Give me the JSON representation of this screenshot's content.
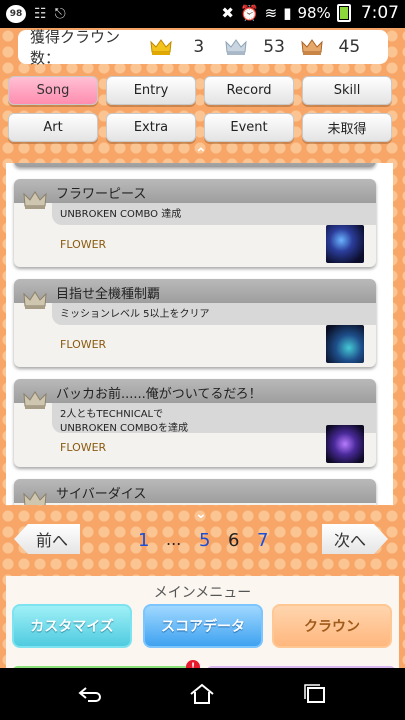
{
  "status_bar": {
    "notification_badge": "98",
    "battery_percent": "98%",
    "time": "7:07"
  },
  "crown_summary": {
    "label": "獲得クラウン数：",
    "gold": "3",
    "silver": "53",
    "bronze": "45",
    "colors": {
      "gold": "#f3c21b",
      "silver": "#b8c8d6",
      "bronze": "#d99a5b"
    }
  },
  "tabs": [
    {
      "label": "Song",
      "active": true
    },
    {
      "label": "Entry",
      "active": false
    },
    {
      "label": "Record",
      "active": false
    },
    {
      "label": "Skill",
      "active": false
    },
    {
      "label": "Art",
      "active": false
    },
    {
      "label": "Extra",
      "active": false
    },
    {
      "label": "Event",
      "active": false
    },
    {
      "label": "未取得",
      "active": false
    }
  ],
  "cards": [
    {
      "title": "フラワーピース",
      "desc": "UNBROKEN COMBO 達成",
      "song": "FLOWER"
    },
    {
      "title": "目指せ全機種制覇",
      "desc": "ミッションレベル 5以上をクリア",
      "song": "FLOWER"
    },
    {
      "title": "バッカお前......俺がついてるだろ！",
      "desc_line1": "2人ともTECHNICALで",
      "desc_line2": "UNBROKEN COMBOを達成",
      "song": "FLOWER"
    },
    {
      "title": "サイバーダイス"
    }
  ],
  "pager": {
    "prev": "前へ",
    "next": "次へ",
    "pages": {
      "first": "1",
      "dots": "...",
      "p5": "5",
      "current": "6",
      "p7": "7"
    }
  },
  "menu": {
    "title": "メインメニュー",
    "customize": "カスタマイズ",
    "score_data": "スコアデータ",
    "crown": "クラウン",
    "alert": "!"
  }
}
